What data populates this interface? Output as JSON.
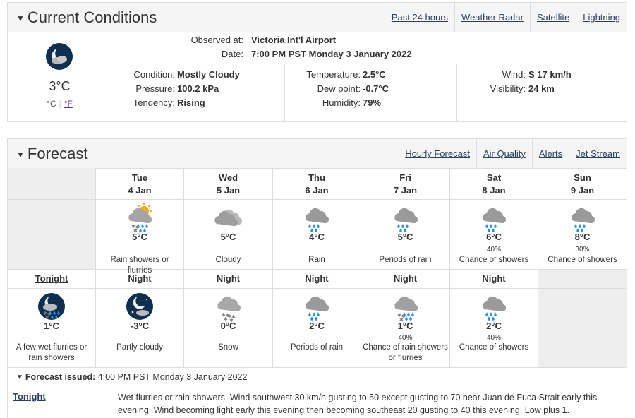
{
  "current": {
    "title": "Current Conditions",
    "links": [
      "Past 24 hours",
      "Weather Radar",
      "Satellite",
      "Lightning"
    ],
    "icon": "night-mostly-cloudy-icon",
    "temp": "3°C",
    "unit_c": "°C",
    "unit_f": "°F",
    "observed_label": "Observed at:",
    "observed_value": "Victoria Int'l Airport",
    "date_label": "Date:",
    "date_value": "7:00 PM PST Monday 3 January 2022",
    "condition_label": "Condition:",
    "condition_value": "Mostly Cloudy",
    "pressure_label": "Pressure:",
    "pressure_value": "100.2 kPa",
    "tendency_label": "Tendency:",
    "tendency_value": "Rising",
    "temperature_label": "Temperature:",
    "temperature_value": "2.5°C",
    "dewpoint_label": "Dew point:",
    "dewpoint_value": "-0.7°C",
    "humidity_label": "Humidity:",
    "humidity_value": "79%",
    "wind_label": "Wind:",
    "wind_value": "S 17 km/h",
    "visibility_label": "Visibility:",
    "visibility_value": "24 km"
  },
  "forecast": {
    "title": "Forecast",
    "links": [
      "Hourly Forecast",
      "Air Quality",
      "Alerts",
      "Jet Stream"
    ],
    "days": [
      {
        "name": "Tue",
        "date": "4 Jan",
        "icon": "sun-cloud-rain-snow-icon",
        "temp": "5°C",
        "pop": "",
        "summary": "Rain showers or flurries"
      },
      {
        "name": "Wed",
        "date": "5 Jan",
        "icon": "cloud-icon",
        "temp": "5°C",
        "pop": "",
        "summary": "Cloudy"
      },
      {
        "name": "Thu",
        "date": "6 Jan",
        "icon": "cloud-rain-icon",
        "temp": "4°C",
        "pop": "",
        "summary": "Rain"
      },
      {
        "name": "Fri",
        "date": "7 Jan",
        "icon": "cloud-rain-icon",
        "temp": "5°C",
        "pop": "",
        "summary": "Periods of rain"
      },
      {
        "name": "Sat",
        "date": "8 Jan",
        "icon": "cloud-rain-icon",
        "temp": "6°C",
        "pop": "40%",
        "summary": "Chance of showers"
      },
      {
        "name": "Sun",
        "date": "9 Jan",
        "icon": "cloud-rain-icon",
        "temp": "8°C",
        "pop": "30%",
        "summary": "Chance of showers"
      }
    ],
    "nights": [
      {
        "name": "Tonight",
        "icon": "night-cloud-rain-snow-icon",
        "temp": "1°C",
        "pop": "",
        "summary": "A few wet flurries or rain showers"
      },
      {
        "name": "Night",
        "icon": "night-partly-cloudy-icon",
        "temp": "-3°C",
        "pop": "",
        "summary": "Partly cloudy"
      },
      {
        "name": "Night",
        "icon": "cloud-snow-icon",
        "temp": "0°C",
        "pop": "",
        "summary": "Snow"
      },
      {
        "name": "Night",
        "icon": "cloud-rain-icon",
        "temp": "2°C",
        "pop": "",
        "summary": "Periods of rain"
      },
      {
        "name": "Night",
        "icon": "cloud-rain-snow-icon",
        "temp": "1°C",
        "pop": "40%",
        "summary": "Chance of rain showers or flurries"
      },
      {
        "name": "Night",
        "icon": "cloud-rain-icon",
        "temp": "2°C",
        "pop": "40%",
        "summary": "Chance of showers"
      }
    ],
    "issued_label": "Forecast issued:",
    "issued_value": "4:00 PM PST Monday 3 January 2022",
    "tonight_label": "Tonight",
    "tonight_text": "Wet flurries or rain showers. Wind southwest 30 km/h gusting to 50 except gusting to 70 near Juan de Fuca Strait early this evening. Wind becoming light early this evening then becoming southeast 20 gusting to 40 this evening. Low plus 1."
  },
  "colors": {
    "link": "#284162",
    "night_bg": "#0e2f4f",
    "cloud": "#9a9a9a",
    "rain": "#2b8fd6",
    "sun": "#f5a623"
  }
}
